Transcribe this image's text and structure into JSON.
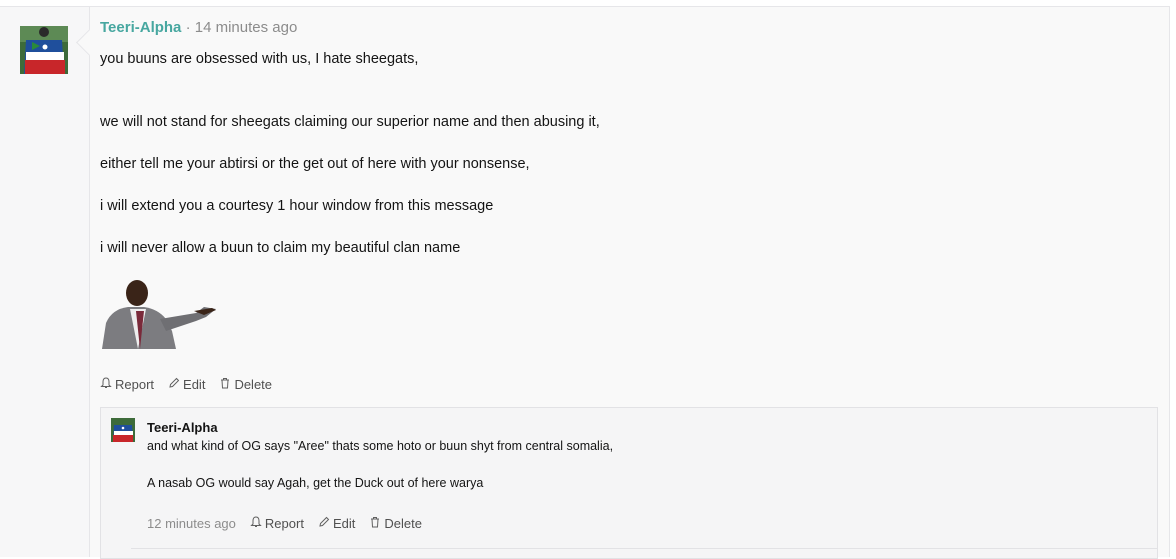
{
  "post": {
    "username": "Teeri-Alpha",
    "separator": "·",
    "time": "14 minutes ago",
    "paragraphs": [
      "you buuns are obsessed with us, I hate sheegats,",
      "we will not stand for sheegats claiming our superior name and then abusing it,",
      "either tell me your abtirsi or the get out of here with your nonsense,",
      "i will extend you a courtesy 1 hour window from this message",
      "i will never allow a buun to claim my beautiful clan name"
    ],
    "actions": {
      "report": "Report",
      "edit": "Edit",
      "delete": "Delete"
    }
  },
  "reply": {
    "username": "Teeri-Alpha",
    "paragraphs": [
      "and what kind of OG says \"Aree\" thats some hoto or buun shyt from central somalia,",
      "A nasab OG would say Agah, get the Duck out of here warya"
    ],
    "time": "12 minutes ago",
    "actions": {
      "report": "Report",
      "edit": "Edit",
      "delete": "Delete"
    }
  },
  "colors": {
    "username": "#47a7a0",
    "meta": "#8c8c8c",
    "text": "#141414"
  },
  "icons": {
    "report": "bell-icon",
    "edit": "pencil-icon",
    "delete": "trash-icon"
  }
}
